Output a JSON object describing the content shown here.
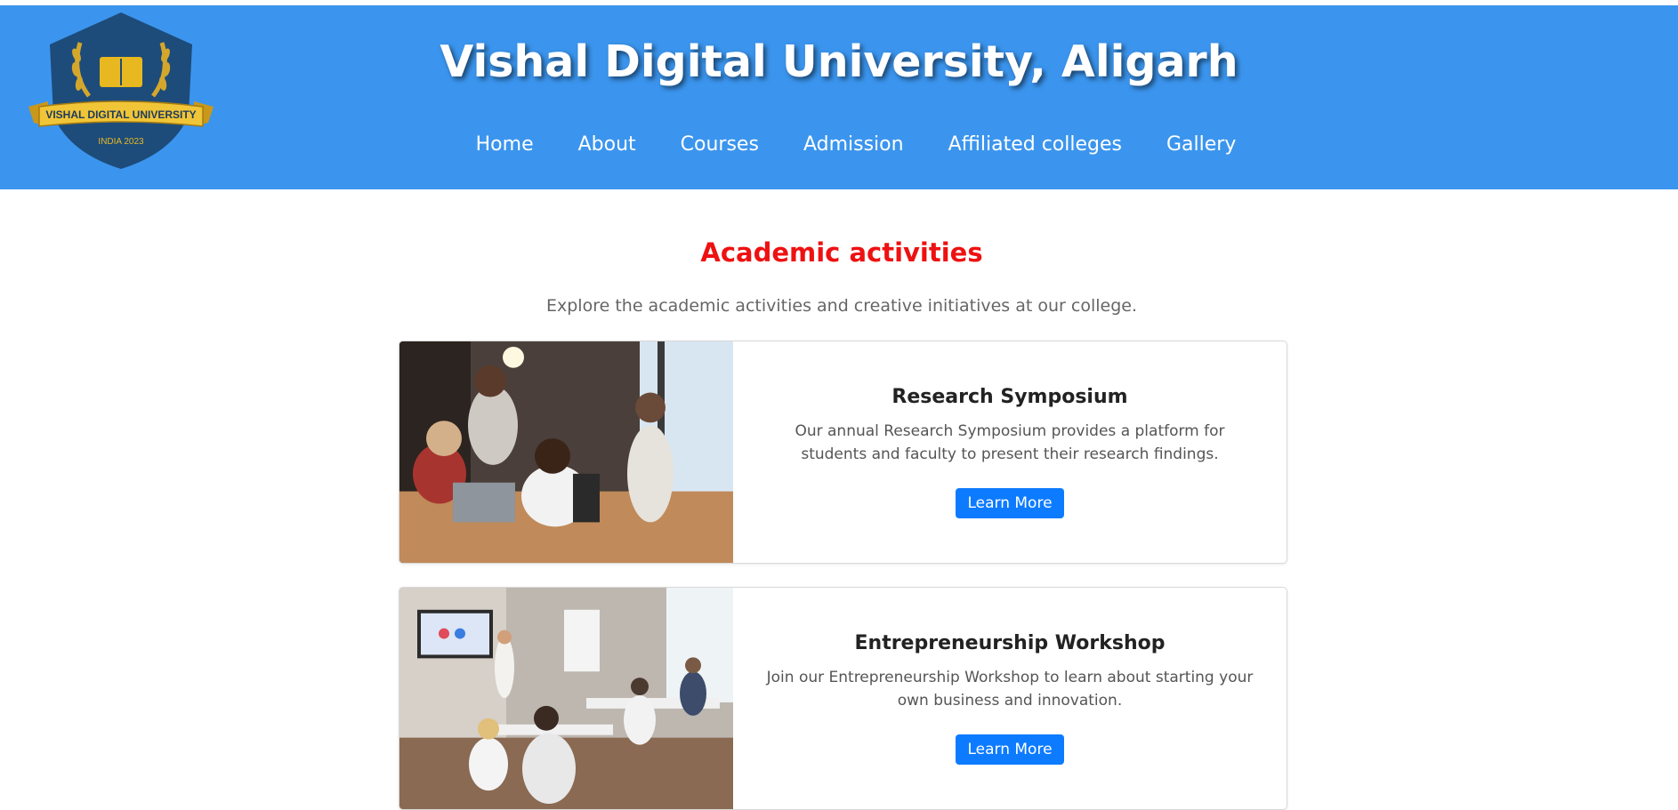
{
  "header": {
    "title": "Vishal Digital University, Aligarh",
    "logo": {
      "banner_text": "VISHAL DIGITAL UNIVERSITY",
      "sub_text": "INDIA 2023"
    },
    "nav": [
      "Home",
      "About",
      "Courses",
      "Admission",
      "Affiliated colleges",
      "Gallery"
    ],
    "background": "#3b95ee"
  },
  "section": {
    "title": "Academic activities",
    "subtitle": "Explore the academic activities and creative initiatives at our college.",
    "title_color": "#ee1111"
  },
  "cards": [
    {
      "title": "Research Symposium",
      "text": "Our annual Research Symposium provides a platform for students and faculty to present their research findings.",
      "button": "Learn More"
    },
    {
      "title": "Entrepreneurship Workshop",
      "text": "Join our Entrepreneurship Workshop to learn about starting your own business and innovation.",
      "button": "Learn More"
    }
  ],
  "colors": {
    "button": "#0d7bff",
    "logo_shield": "#1d4c7a",
    "logo_gold": "#e8b820"
  }
}
